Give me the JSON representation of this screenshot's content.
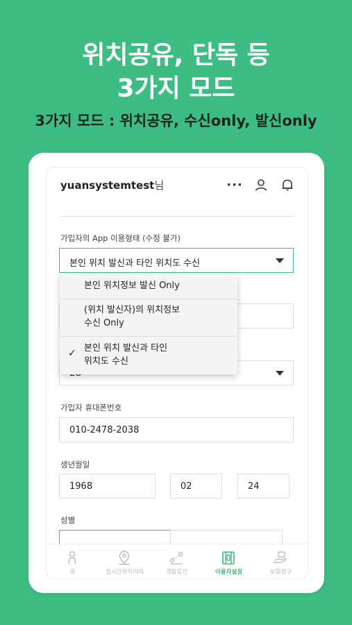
{
  "promo": {
    "headline_line1": "위치공유, 단독 등",
    "headline_line2": "3가지 모드",
    "subline": "3가지 모드 : 위치공유, 수신only, 발신only"
  },
  "header": {
    "username": "yuansystemtest",
    "username_suffix": "님"
  },
  "form": {
    "usage_label": "가입자의 App 이용형태 (수정 불가)",
    "usage_value": "본인 위치 발신과 타인 위치도 수신",
    "carrier_value": "LG ",
    "phone_label": "가입자 휴대폰번호",
    "phone_value": "010-2478-2038",
    "birth_label": "생년월일",
    "birth_year": "1968",
    "birth_month": "02",
    "birth_day": "24",
    "gender_label": "성별"
  },
  "dropdown": {
    "options": [
      {
        "line1": "본인 위치정보 발신 Only",
        "line2": "",
        "selected": false
      },
      {
        "line1": "(위치 발신자)의 위치정보",
        "line2": "수신 Only",
        "selected": false
      },
      {
        "line1": "본인 위치 발신과 타인",
        "line2": "위치도 수신",
        "selected": true
      }
    ],
    "check_mark": "✓"
  },
  "tabbar": {
    "items": [
      {
        "label": "홈",
        "icon": "home-person-icon"
      },
      {
        "label": "실시간위치이력",
        "icon": "location-person-icon"
      },
      {
        "label": "생활동선",
        "icon": "route-icon"
      },
      {
        "label": "이용자설정",
        "icon": "settings-doc-icon",
        "active": true
      },
      {
        "label": "보험청구",
        "icon": "insurance-hand-icon"
      }
    ]
  },
  "colors": {
    "brand": "#3dbd83",
    "active_tab": "#2fae74"
  }
}
